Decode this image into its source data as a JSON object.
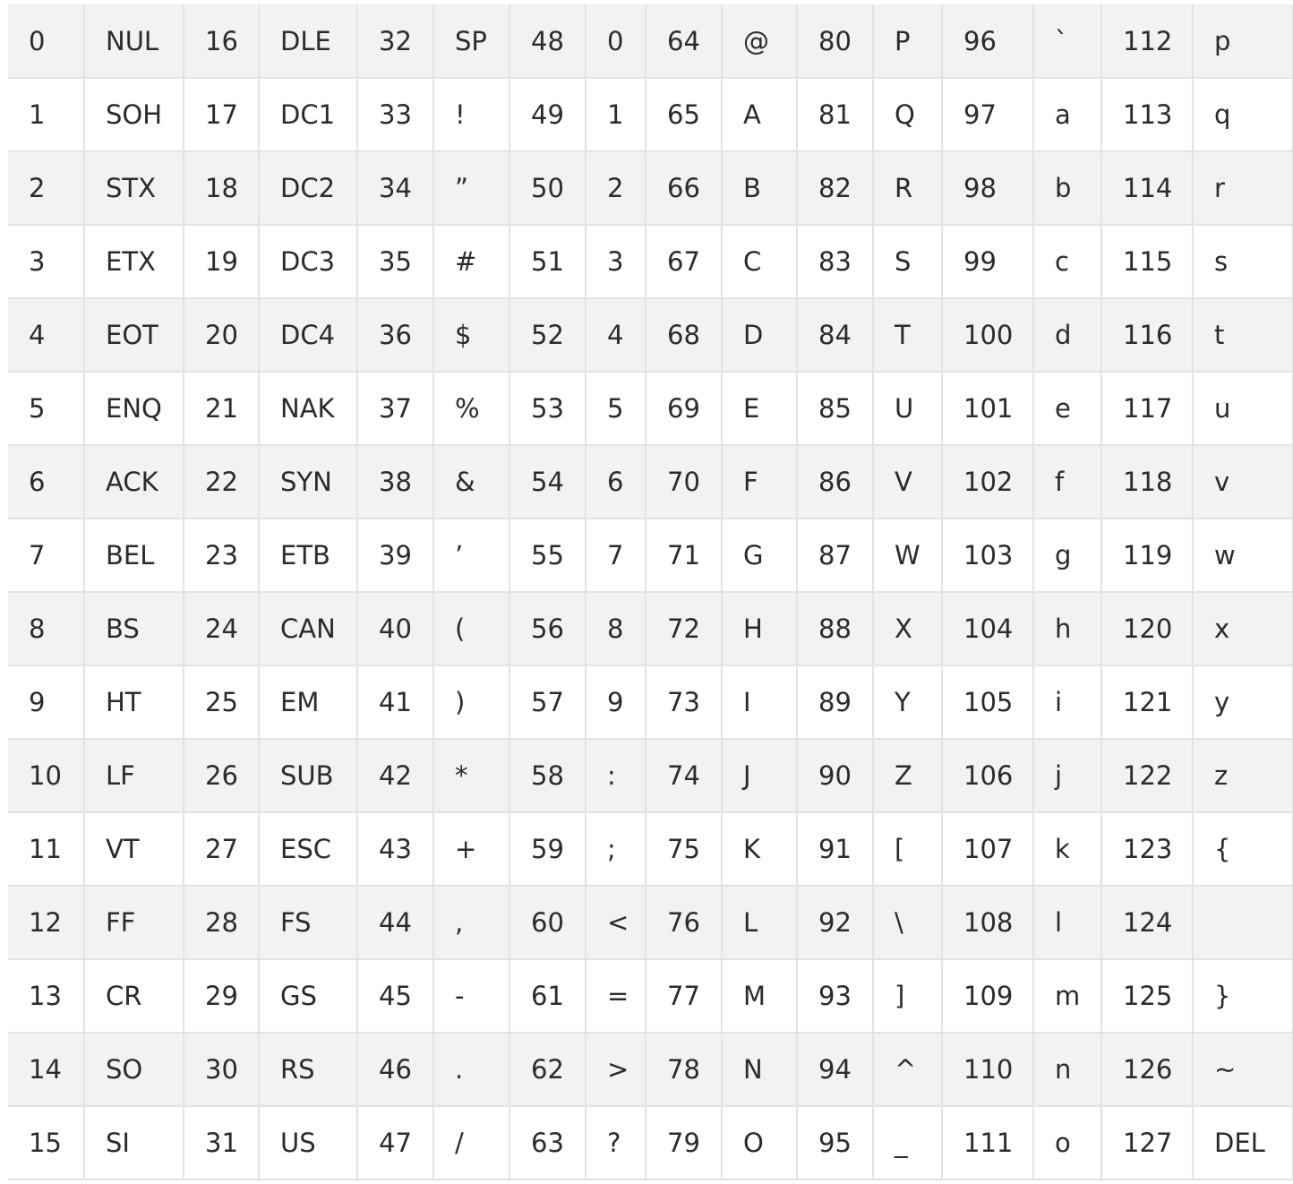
{
  "ascii_table": {
    "rows": [
      [
        "0",
        "NUL",
        "16",
        "DLE",
        "32",
        "SP",
        "48",
        "0",
        "64",
        "@",
        "80",
        "P",
        "96",
        "`",
        "112",
        "p"
      ],
      [
        "1",
        "SOH",
        "17",
        "DC1",
        "33",
        "!",
        "49",
        "1",
        "65",
        "A",
        "81",
        "Q",
        "97",
        "a",
        "113",
        "q"
      ],
      [
        "2",
        "STX",
        "18",
        "DC2",
        "34",
        "”",
        "50",
        "2",
        "66",
        "B",
        "82",
        "R",
        "98",
        "b",
        "114",
        "r"
      ],
      [
        "3",
        "ETX",
        "19",
        "DC3",
        "35",
        "#",
        "51",
        "3",
        "67",
        "C",
        "83",
        "S",
        "99",
        "c",
        "115",
        "s"
      ],
      [
        "4",
        "EOT",
        "20",
        "DC4",
        "36",
        "$",
        "52",
        "4",
        "68",
        "D",
        "84",
        "T",
        "100",
        "d",
        "116",
        "t"
      ],
      [
        "5",
        "ENQ",
        "21",
        "NAK",
        "37",
        "%",
        "53",
        "5",
        "69",
        "E",
        "85",
        "U",
        "101",
        "e",
        "117",
        "u"
      ],
      [
        "6",
        "ACK",
        "22",
        "SYN",
        "38",
        "&",
        "54",
        "6",
        "70",
        "F",
        "86",
        "V",
        "102",
        "f",
        "118",
        "v"
      ],
      [
        "7",
        "BEL",
        "23",
        "ETB",
        "39",
        "’",
        "55",
        "7",
        "71",
        "G",
        "87",
        "W",
        "103",
        "g",
        "119",
        "w"
      ],
      [
        "8",
        "BS",
        "24",
        "CAN",
        "40",
        "(",
        "56",
        "8",
        "72",
        "H",
        "88",
        "X",
        "104",
        "h",
        "120",
        "x"
      ],
      [
        "9",
        "HT",
        "25",
        "EM",
        "41",
        ")",
        "57",
        "9",
        "73",
        "I",
        "89",
        "Y",
        "105",
        "i",
        "121",
        "y"
      ],
      [
        "10",
        "LF",
        "26",
        "SUB",
        "42",
        "*",
        "58",
        ":",
        "74",
        "J",
        "90",
        "Z",
        "106",
        "j",
        "122",
        "z"
      ],
      [
        "11",
        "VT",
        "27",
        "ESC",
        "43",
        "+",
        "59",
        ";",
        "75",
        "K",
        "91",
        "[",
        "107",
        "k",
        "123",
        "{"
      ],
      [
        "12",
        "FF",
        "28",
        "FS",
        "44",
        ",",
        "60",
        "<",
        "76",
        "L",
        "92",
        "\\",
        "108",
        "l",
        "124",
        ""
      ],
      [
        "13",
        "CR",
        "29",
        "GS",
        "45",
        "-",
        "61",
        "=",
        "77",
        "M",
        "93",
        "]",
        "109",
        "m",
        "125",
        "}"
      ],
      [
        "14",
        "SO",
        "30",
        "RS",
        "46",
        ".",
        "62",
        ">",
        "78",
        "N",
        "94",
        "^",
        "110",
        "n",
        "126",
        "~"
      ],
      [
        "15",
        "SI",
        "31",
        "US",
        "47",
        "/",
        "63",
        "?",
        "79",
        "O",
        "95",
        "_",
        "111",
        "o",
        "127",
        "DEL"
      ]
    ]
  },
  "colors": {
    "stripe": "#f2f2f2",
    "background": "#ffffff",
    "border": "#e3e3e3",
    "text": "#2b2b2b"
  }
}
